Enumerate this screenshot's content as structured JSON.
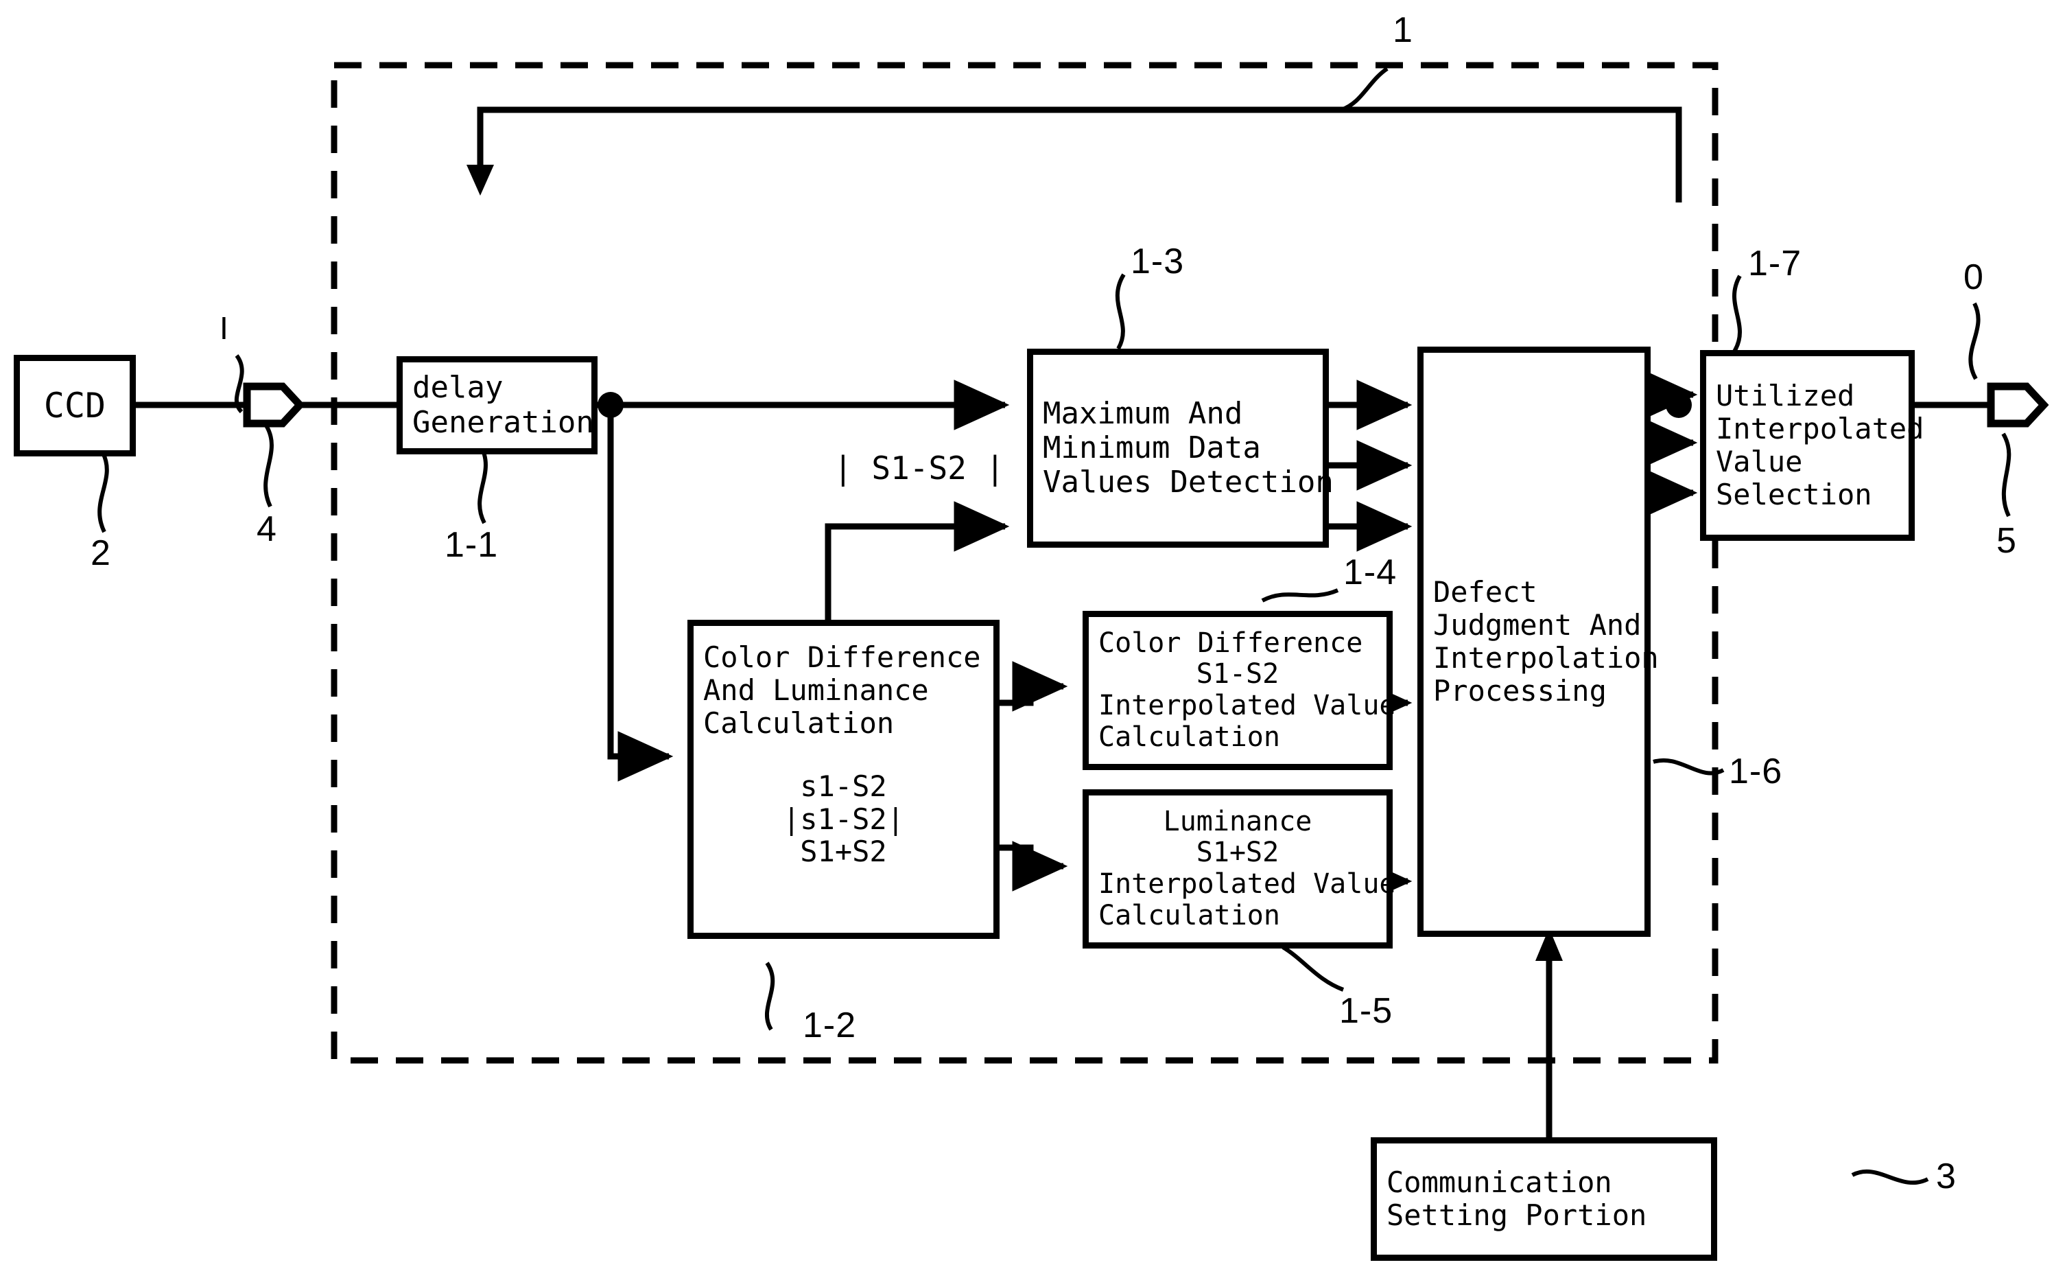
{
  "diagram": {
    "figure_kind": "patent-block-diagram",
    "enclosure_ref": "1",
    "blocks": {
      "ccd": {
        "label": "CCD",
        "ref": "2"
      },
      "delay_generation": {
        "lines": [
          "delay",
          "Generation"
        ],
        "ref": "1-1"
      },
      "color_difference_luminance": {
        "lines": [
          "Color Difference",
          "And Luminance",
          "Calculation"
        ],
        "formulas": [
          "s1-S2",
          "|s1-S2|",
          "S1+S2"
        ],
        "ref": "1-2"
      },
      "max_min_detection": {
        "lines": [
          "Maximum And",
          "Minimum Data",
          "Values Detection"
        ],
        "ref": "1-3"
      },
      "color_difference_interp": {
        "lines": [
          "Color Difference",
          "S1-S2",
          "Interpolated Value",
          "Calculation"
        ],
        "ref": "1-4"
      },
      "luminance_interp": {
        "lines": [
          "Luminance",
          "S1+S2",
          "Interpolated Value",
          "Calculation"
        ],
        "ref": "1-5"
      },
      "defect_judgment": {
        "lines": [
          "Defect",
          "Judgment And",
          "Interpolation",
          "Processing"
        ],
        "ref": "1-6"
      },
      "utilized_selection": {
        "lines": [
          "Utilized",
          "Interpolated",
          "Value",
          "Selection"
        ],
        "ref": "1-7"
      },
      "communication_setting": {
        "lines": [
          "Communication",
          "Setting Portion"
        ],
        "ref": "3"
      }
    },
    "connectors": {
      "input_terminal_ref": "4",
      "input_signal_label": "I",
      "output_terminal_ref": "5",
      "output_signal_label": "0",
      "abs_diff_label": "| S1-S2 |"
    }
  },
  "colors": {
    "ink": "#000000",
    "paper": "#ffffff"
  }
}
